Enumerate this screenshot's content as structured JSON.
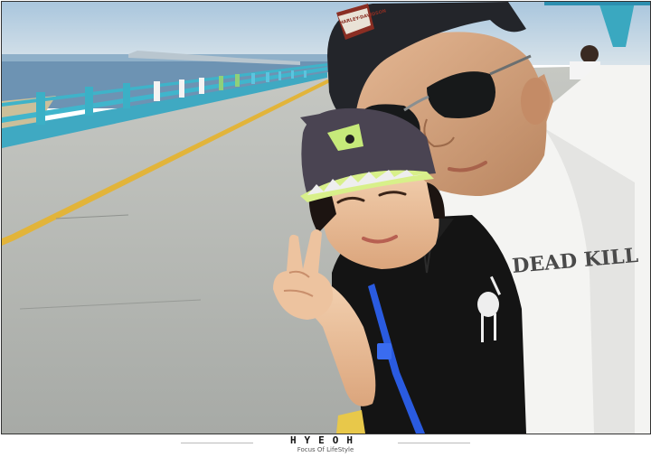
{
  "photo": {
    "shirt_text": "DEAD KILL",
    "cap_text": "HARLEY-DAVIDSON"
  },
  "footer": {
    "brand": "HYEOH",
    "tagline": "Focus Of LifeStyle"
  },
  "colors": {
    "sky": "#c9dbe9",
    "sea": "#5b86a8",
    "railing": "#3fb3c9",
    "road": "#b9bcb8",
    "road_line": "#e2b43a"
  }
}
